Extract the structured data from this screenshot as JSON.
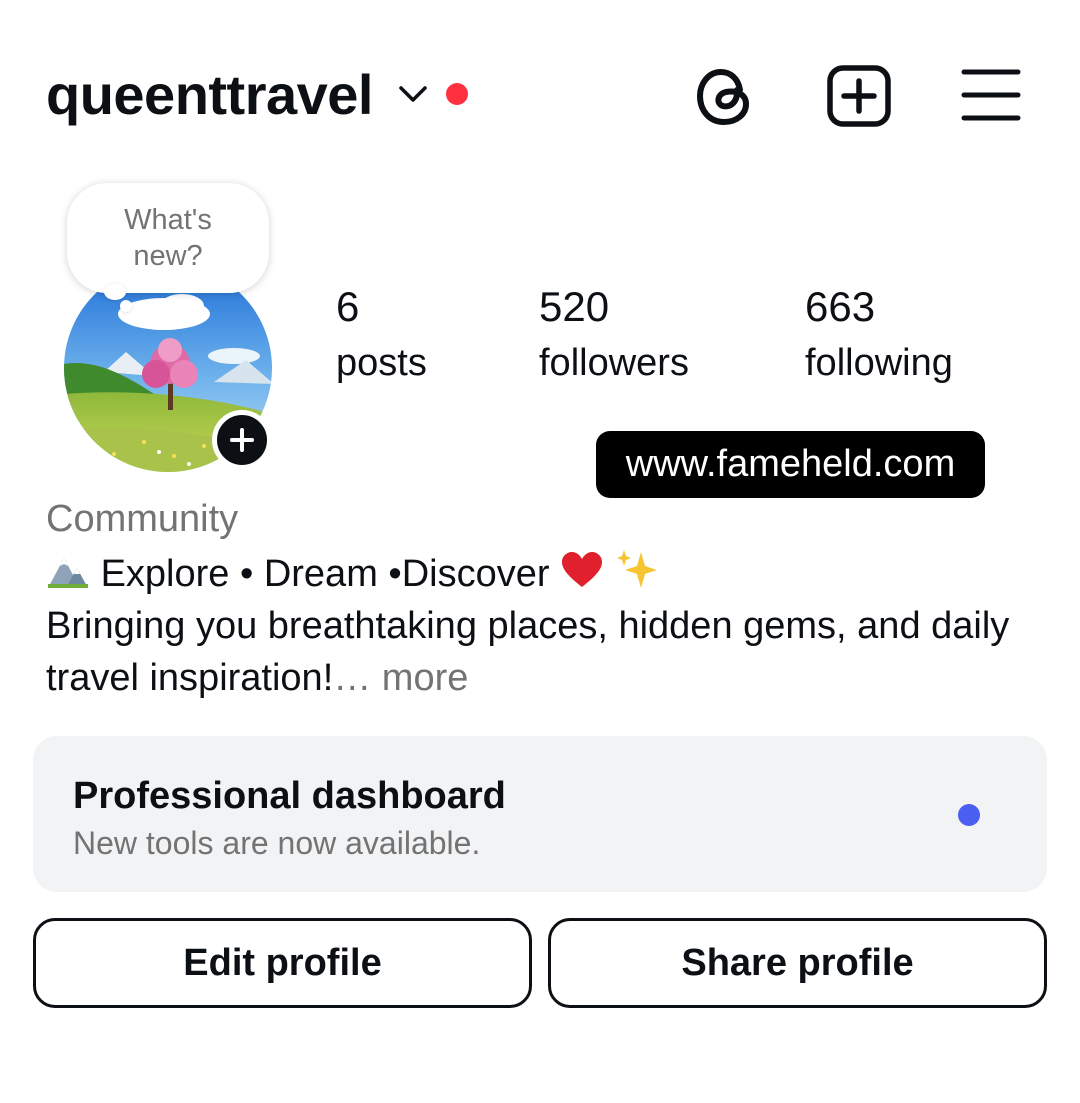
{
  "header": {
    "username": "queenttravel",
    "notification_color": "#ff3040",
    "icons": [
      "chevron-down-icon",
      "threads-icon",
      "plus-square-icon",
      "menu-icon"
    ]
  },
  "note_bubble": {
    "text": "What's new?"
  },
  "stats": {
    "posts": {
      "count": "6",
      "label": "posts"
    },
    "followers": {
      "count": "520",
      "label": "followers"
    },
    "following": {
      "count": "663",
      "label": "following"
    }
  },
  "link_badge": "www.fameheld.com",
  "bio": {
    "category": "Community",
    "tagline": "Explore • Dream •Discover",
    "line2": "Bringing you breathtaking places, hidden gems, and daily",
    "line3": "travel inspiration!",
    "more": "… more"
  },
  "dashboard": {
    "title": "Professional dashboard",
    "subtitle": "New tools are now available.",
    "dot_color": "#4a5ef2"
  },
  "buttons": {
    "edit": "Edit profile",
    "share": "Share profile"
  }
}
